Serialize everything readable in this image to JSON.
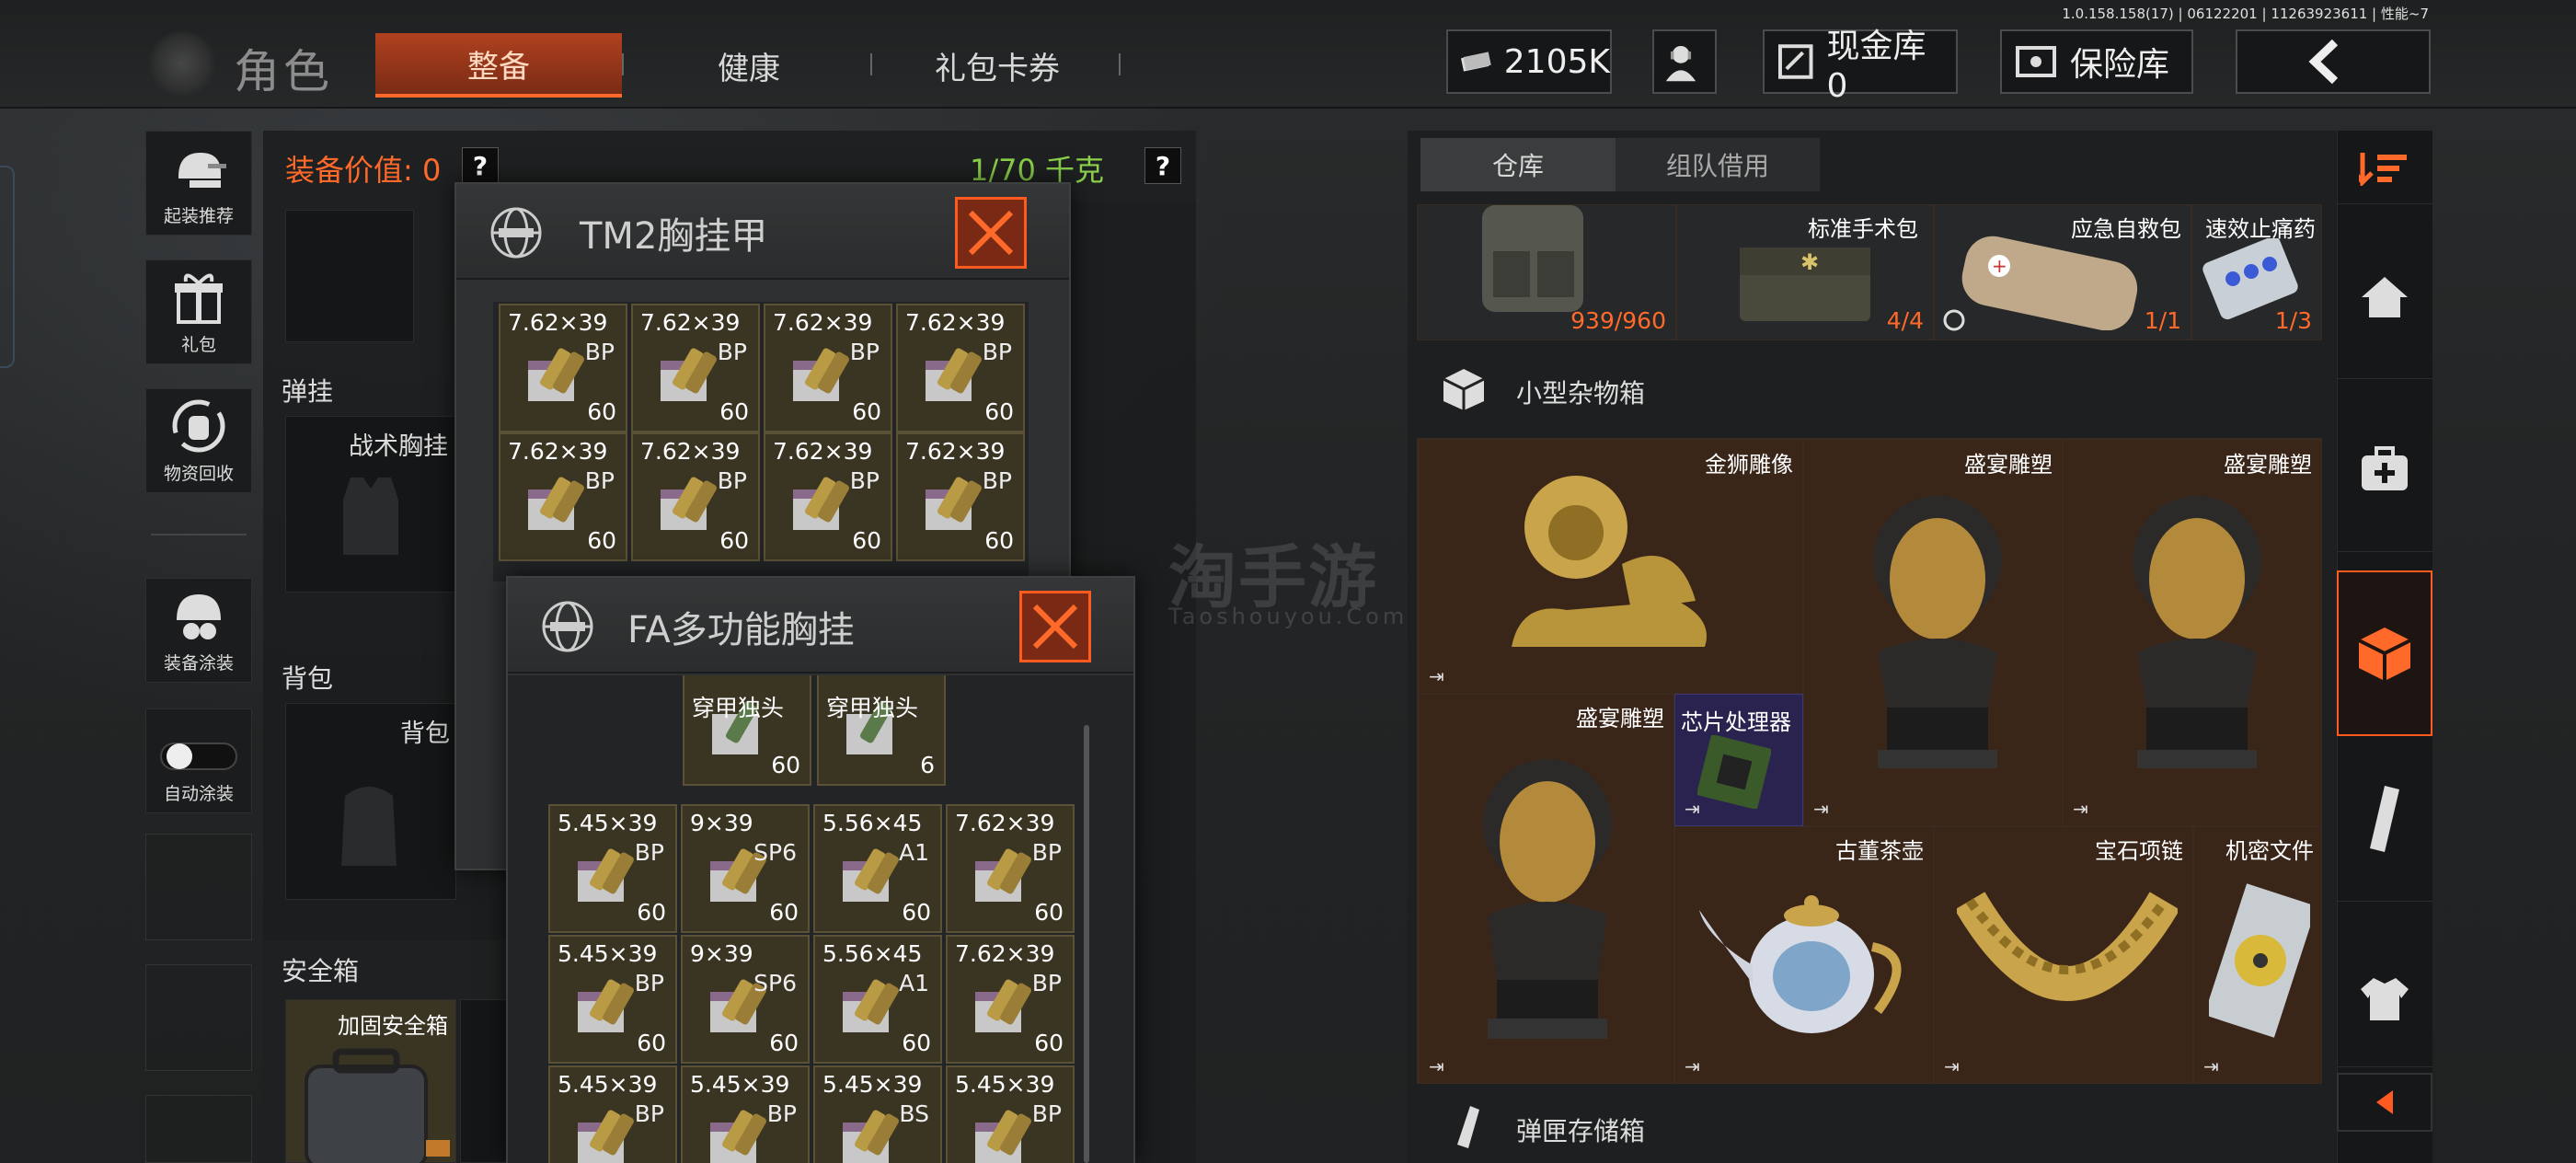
{
  "version": "1.0.158.158(17) | 06122201 | 11263923611 | 性能~7",
  "header": {
    "title": "角色",
    "tabs": [
      {
        "label": "整备"
      },
      {
        "label": "健康"
      },
      {
        "label": "礼包卡券"
      }
    ],
    "money": "2105K",
    "cash_vault": "现金库 0",
    "insurance": "保险库",
    "back_icon": "chevron-left-icon"
  },
  "left_rail": [
    {
      "label": "起装推荐",
      "icon": "helmet-gun-icon"
    },
    {
      "label": "礼包",
      "icon": "gift-icon"
    },
    {
      "label": "物资回收",
      "icon": "recycle-bag-icon"
    },
    {
      "label": "装备涂装",
      "icon": "helmet-paint-icon"
    },
    {
      "label": "自动涂装",
      "icon": "toggle-icon"
    }
  ],
  "equip": {
    "value_label": "装备价值: 0",
    "help": "?",
    "weight": "1/70 千克",
    "sections": {
      "ammo_rig": "弹挂",
      "rig_name": "战术胸挂",
      "backpack": "背包",
      "backpack_name": "背包",
      "safe": "安全箱",
      "safe_name": "加固安全箱"
    }
  },
  "popup_tm2": {
    "title": "TM2胸挂甲",
    "ammo": [
      {
        "cal": "7.62×39",
        "type": "BP",
        "count": "60"
      },
      {
        "cal": "7.62×39",
        "type": "BP",
        "count": "60"
      },
      {
        "cal": "7.62×39",
        "type": "BP",
        "count": "60"
      },
      {
        "cal": "7.62×39",
        "type": "BP",
        "count": "60"
      },
      {
        "cal": "7.62×39",
        "type": "BP",
        "count": "60"
      },
      {
        "cal": "7.62×39",
        "type": "BP",
        "count": "60"
      },
      {
        "cal": "7.62×39",
        "type": "BP",
        "count": "60"
      },
      {
        "cal": "7.62×39",
        "type": "BP",
        "count": "60"
      }
    ]
  },
  "popup_fa": {
    "title": "FA多功能胸挂",
    "top_partial": [
      {
        "label": "穿甲独头",
        "count": "60"
      },
      {
        "label": "穿甲独头",
        "count": "6"
      }
    ],
    "ammo": [
      {
        "cal": "5.45×39",
        "type": "BP",
        "count": "60"
      },
      {
        "cal": "9×39",
        "type": "SP6",
        "count": "60"
      },
      {
        "cal": "5.56×45",
        "type": "A1",
        "count": "60"
      },
      {
        "cal": "7.62×39",
        "type": "BP",
        "count": "60"
      },
      {
        "cal": "5.45×39",
        "type": "BP",
        "count": "60"
      },
      {
        "cal": "9×39",
        "type": "SP6",
        "count": "60"
      },
      {
        "cal": "5.56×45",
        "type": "A1",
        "count": "60"
      },
      {
        "cal": "7.62×39",
        "type": "BP",
        "count": "60"
      },
      {
        "cal": "5.45×39",
        "type": "BP",
        "count": ""
      },
      {
        "cal": "5.45×39",
        "type": "BP",
        "count": ""
      },
      {
        "cal": "5.45×39",
        "type": "BS",
        "count": ""
      },
      {
        "cal": "5.45×39",
        "type": "BP",
        "count": ""
      }
    ]
  },
  "storage": {
    "tabs": [
      {
        "label": "仓库"
      },
      {
        "label": "组队借用"
      }
    ],
    "top_row": [
      {
        "name": "",
        "count": "939/960"
      },
      {
        "name": "标准手术包",
        "count": "4/4"
      },
      {
        "name": "应急自救包",
        "count": "1/1"
      },
      {
        "name": "速效止痛药",
        "count": "1/3"
      }
    ],
    "container_title": "小型杂物箱",
    "items": [
      {
        "name": "金狮雕像"
      },
      {
        "name": "盛宴雕塑"
      },
      {
        "name": "盛宴雕塑"
      },
      {
        "name": "盛宴雕塑"
      },
      {
        "name": "芯片处理器"
      },
      {
        "name": "古董茶壶"
      },
      {
        "name": "宝石项链"
      },
      {
        "name": "机密文件"
      }
    ],
    "next_container": "弹匣存储箱"
  },
  "right_rail": [
    "filter-icon",
    "home-icon",
    "medkit-icon",
    "box-icon",
    "magazine-icon",
    "shirt-icon",
    "collapse-left-icon"
  ],
  "watermark": {
    "cn": "淘手游",
    "en": "Taoshouyou.Com"
  },
  "colors": {
    "accent": "#ff6a2a",
    "weight_green": "#8bd14a",
    "item_bg": "#3a2519",
    "ammo_bg": "#3a3423"
  }
}
